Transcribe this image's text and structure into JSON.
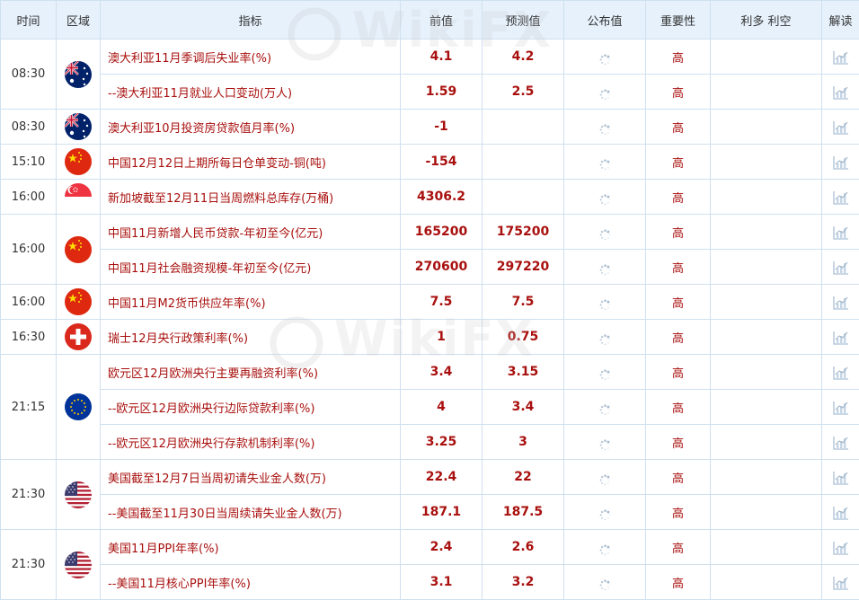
{
  "header": {
    "time": "时间",
    "region": "区域",
    "indicator": "指标",
    "previous": "前值",
    "forecast": "预测值",
    "actual": "公布值",
    "importance": "重要性",
    "impact": "利多 利空",
    "analysis": "解读"
  },
  "watermark": "WikiFX",
  "groups": [
    {
      "time": "08:30",
      "flag": "australia-flag-icon",
      "rows": [
        {
          "indicator": "澳大利亚11月季调后失业率(%)",
          "previous": "4.1",
          "forecast": "4.2",
          "importance": "高"
        },
        {
          "indicator": "--澳大利亚11月就业人口变动(万人)",
          "previous": "1.59",
          "forecast": "2.5",
          "importance": "高"
        }
      ]
    },
    {
      "time": "08:30",
      "flag": "australia-flag-icon",
      "rows": [
        {
          "indicator": "澳大利亚10月投资房贷款值月率(%)",
          "previous": "-1",
          "forecast": "",
          "importance": "高"
        }
      ]
    },
    {
      "time": "15:10",
      "flag": "china-flag-icon",
      "rows": [
        {
          "indicator": "中国12月12日上期所每日仓单变动-铜(吨)",
          "previous": "-154",
          "forecast": "",
          "importance": "高"
        }
      ]
    },
    {
      "time": "16:00",
      "flag": "singapore-flag-icon",
      "rows": [
        {
          "indicator": "新加坡截至12月11日当周燃料总库存(万桶)",
          "previous": "4306.2",
          "forecast": "",
          "importance": "高"
        }
      ]
    },
    {
      "time": "16:00",
      "flag": "china-flag-icon",
      "rows": [
        {
          "indicator": "中国11月新增人民币贷款-年初至今(亿元)",
          "previous": "165200",
          "forecast": "175200",
          "importance": "高"
        },
        {
          "indicator": "中国11月社会融资规模-年初至今(亿元)",
          "previous": "270600",
          "forecast": "297220",
          "importance": "高"
        }
      ]
    },
    {
      "time": "16:00",
      "flag": "china-flag-icon",
      "rows": [
        {
          "indicator": "中国11月M2货币供应年率(%)",
          "previous": "7.5",
          "forecast": "7.5",
          "importance": "高"
        }
      ]
    },
    {
      "time": "16:30",
      "flag": "switzerland-flag-icon",
      "rows": [
        {
          "indicator": "瑞士12月央行政策利率(%)",
          "previous": "1",
          "forecast": "0.75",
          "importance": "高"
        }
      ]
    },
    {
      "time": "21:15",
      "flag": "eu-flag-icon",
      "rows": [
        {
          "indicator": "欧元区12月欧洲央行主要再融资利率(%)",
          "previous": "3.4",
          "forecast": "3.15",
          "importance": "高"
        },
        {
          "indicator": "--欧元区12月欧洲央行边际贷款利率(%)",
          "previous": "4",
          "forecast": "3.4",
          "importance": "高"
        },
        {
          "indicator": "--欧元区12月欧洲央行存款机制利率(%)",
          "previous": "3.25",
          "forecast": "3",
          "importance": "高"
        }
      ]
    },
    {
      "time": "21:30",
      "flag": "usa-flag-icon",
      "rows": [
        {
          "indicator": "美国截至12月7日当周初请失业金人数(万)",
          "previous": "22.4",
          "forecast": "22",
          "importance": "高"
        },
        {
          "indicator": "--美国截至11月30日当周续请失业金人数(万)",
          "previous": "187.1",
          "forecast": "187.5",
          "importance": "高"
        }
      ]
    },
    {
      "time": "21:30",
      "flag": "usa-flag-icon",
      "rows": [
        {
          "indicator": "美国11月PPI年率(%)",
          "previous": "2.4",
          "forecast": "2.6",
          "importance": "高"
        },
        {
          "indicator": "--美国11月核心PPI年率(%)",
          "previous": "3.1",
          "forecast": "3.2",
          "importance": "高"
        }
      ]
    }
  ]
}
